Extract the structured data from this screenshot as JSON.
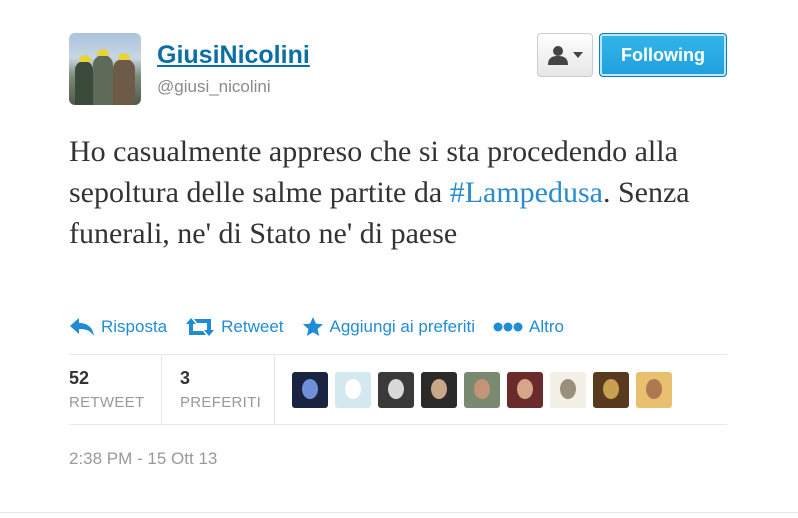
{
  "user": {
    "display_name": "GiusiNicolini",
    "screen_name": "@giusi_nicolini",
    "avatar_icon": "profile-photo"
  },
  "follow_button": {
    "label": "Following",
    "color": "#1fa0de"
  },
  "user_menu": {
    "icon": "user-dropdown-icon"
  },
  "tweet": {
    "text_before": "Ho casualmente appreso che si sta procedendo alla sepoltura delle salme partite da ",
    "hashtag": "#Lampedusa",
    "text_after": ". Senza funerali, ne' di Stato ne' di paese",
    "hashtag_color": "#2a8ccf"
  },
  "actions": [
    {
      "label": "Risposta",
      "icon": "reply-icon"
    },
    {
      "label": "Retweet",
      "icon": "retweet-icon"
    },
    {
      "label": "Aggiungi ai preferiti",
      "icon": "star-icon"
    },
    {
      "label": "Altro",
      "icon": "more-icon"
    }
  ],
  "stats": {
    "retweets": {
      "count": "52",
      "label": "RETWEET"
    },
    "favorites": {
      "count": "3",
      "label": "PREFERITI"
    }
  },
  "timestamp": "2:38 PM - 15 Ott 13",
  "favoriters": [
    {
      "name": "favoriter-1",
      "bg": "#1a2340",
      "accent": "#6f8fd8"
    },
    {
      "name": "favoriter-2",
      "bg": "#d4e8ef",
      "accent": "#ffffff"
    },
    {
      "name": "favoriter-3",
      "bg": "#3a3a3a",
      "accent": "#d8d8d8"
    },
    {
      "name": "favoriter-4",
      "bg": "#2b2a28",
      "accent": "#c9a88a"
    },
    {
      "name": "favoriter-5",
      "bg": "#7a8a70",
      "accent": "#c39478"
    },
    {
      "name": "favoriter-6",
      "bg": "#6b2b2b",
      "accent": "#d7a58a"
    },
    {
      "name": "favoriter-7",
      "bg": "#f3f0e8",
      "accent": "#9a8f7c"
    },
    {
      "name": "favoriter-8",
      "bg": "#5a3a1e",
      "accent": "#c8a050"
    },
    {
      "name": "favoriter-9",
      "bg": "#e8c070",
      "accent": "#b07850"
    }
  ]
}
